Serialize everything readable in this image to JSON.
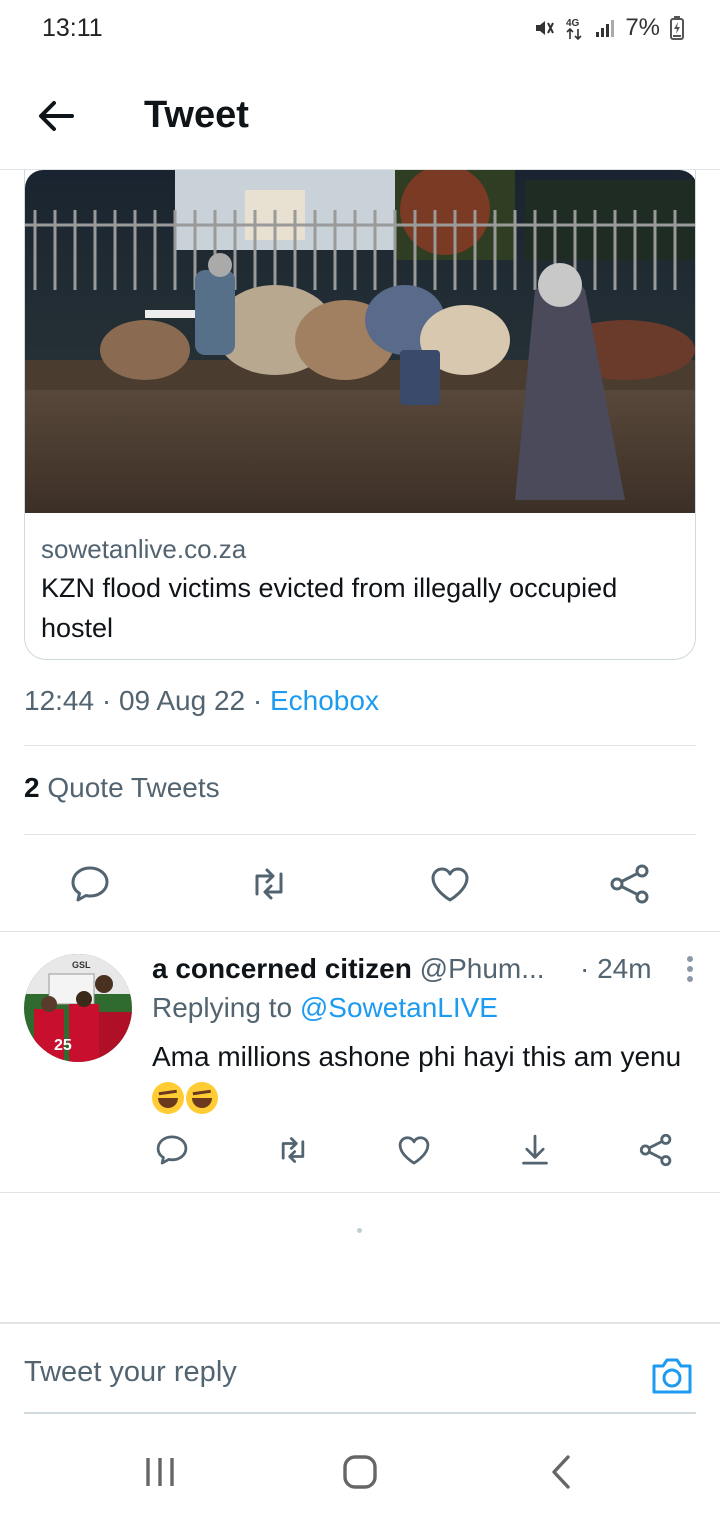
{
  "status_bar": {
    "time": "13:11",
    "network": "4G",
    "battery": "7%",
    "icons": [
      "mute-vibrate-icon",
      "network-4g-icon",
      "signal-bars-icon",
      "battery-charging-icon"
    ]
  },
  "header": {
    "title": "Tweet",
    "back_icon": "back-arrow-icon"
  },
  "link_card": {
    "image_description_icon": "news-photo",
    "domain": "sowetanlive.co.za",
    "title": "KZN flood victims evicted from illegally occupied hostel"
  },
  "tweet_meta": {
    "time": "12:44",
    "date": "09 Aug 22",
    "source": "Echobox",
    "separator": "·"
  },
  "quote_tweets": {
    "count": "2",
    "label": "Quote Tweets"
  },
  "actions": [
    "reply-icon",
    "retweet-icon",
    "like-icon",
    "share-icon"
  ],
  "reply": {
    "name": "a concerned citizen",
    "handle": "@Phum...",
    "time": "· 24m",
    "replying_label": "Replying to",
    "replying_to": "@SowetanLIVE",
    "text": "Ama millions ashone phi hayi this am yenu",
    "emojis": [
      "rolling-on-floor-laughing-emoji",
      "rolling-on-floor-laughing-emoji"
    ],
    "actions": [
      "reply-icon",
      "retweet-icon",
      "like-icon",
      "download-icon",
      "share-icon"
    ]
  },
  "compose": {
    "placeholder": "Tweet your reply",
    "camera_icon": "camera-icon"
  },
  "nav": [
    "recents-icon",
    "home-icon",
    "back-icon"
  ],
  "colors": {
    "accent": "#1d9bf0",
    "text_primary": "#0f1419",
    "text_secondary": "#536471",
    "divider": "#e1e4e6"
  }
}
